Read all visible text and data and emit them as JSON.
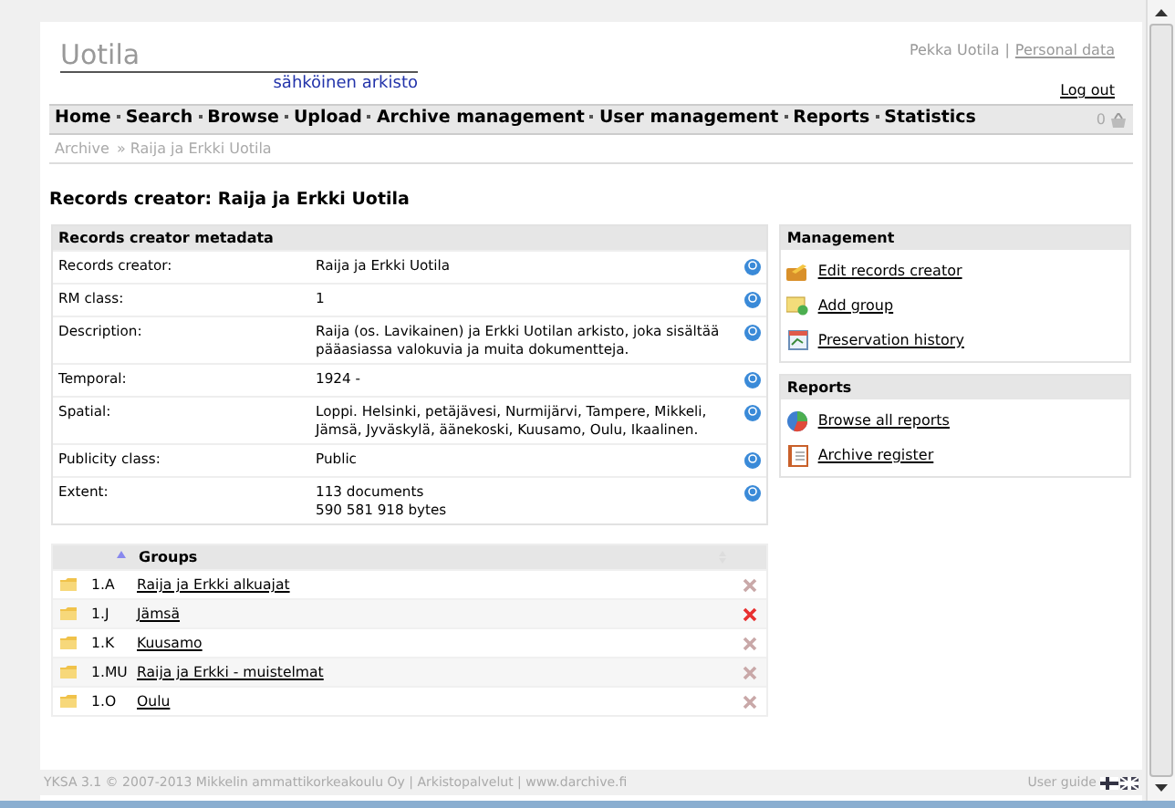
{
  "header": {
    "logo": "Uotila",
    "subtitle": "sähköinen arkisto",
    "user": "Pekka Uotila",
    "separator": "|",
    "personal_link": "Personal data",
    "logout": "Log out"
  },
  "nav": {
    "items": [
      "Home",
      "Search",
      "Browse",
      "Upload",
      "Archive management",
      "User management",
      "Reports",
      "Statistics"
    ],
    "basket_count": "0"
  },
  "breadcrumb": [
    "Archive",
    "» Raija ja Erkki Uotila"
  ],
  "page_title": "Records creator: Raija ja Erkki Uotila",
  "metadata": {
    "title": "Records creator metadata",
    "rows": [
      {
        "label": "Records creator:",
        "value": [
          "Raija ja Erkki Uotila"
        ]
      },
      {
        "label": "RM class:",
        "value": [
          "1"
        ]
      },
      {
        "label": "Description:",
        "value": [
          "Raija (os. Lavikainen) ja Erkki Uotilan arkisto, joka sisältää pääasiassa valokuvia ja muita dokumentteja."
        ]
      },
      {
        "label": "Temporal:",
        "value": [
          "1924 -"
        ]
      },
      {
        "label": "Spatial:",
        "value": [
          "Loppi. Helsinki, petäjävesi, Nurmijärvi, Tampere, Mikkeli, Jämsä, Jyväskylä, äänekoski, Kuusamo, Oulu, Ikaalinen."
        ]
      },
      {
        "label": "Publicity class:",
        "value": [
          "Public"
        ]
      },
      {
        "label": "Extent:",
        "value": [
          "113 documents",
          "590 581 918 bytes"
        ]
      }
    ]
  },
  "groups": {
    "column": "Groups",
    "rows": [
      {
        "code": "1.A",
        "name": "Raija ja Erkki alkuajat",
        "highlighted": false
      },
      {
        "code": "1.J",
        "name": "Jämsä",
        "highlighted": true
      },
      {
        "code": "1.K",
        "name": "Kuusamo",
        "highlighted": false
      },
      {
        "code": "1.MU",
        "name": "Raija ja Erkki - muistelmat",
        "highlighted": false
      },
      {
        "code": "1.O",
        "name": "Oulu",
        "highlighted": false
      }
    ]
  },
  "management": {
    "title": "Management",
    "links": [
      {
        "label": "Edit records creator",
        "kind": "edit"
      },
      {
        "label": "Add group",
        "kind": "add"
      },
      {
        "label": "Preservation history",
        "kind": "history"
      }
    ]
  },
  "reports": {
    "title": "Reports",
    "links": [
      {
        "label": "Browse all reports",
        "kind": "chart"
      },
      {
        "label": "Archive register",
        "kind": "register"
      }
    ]
  },
  "footer": {
    "text": "YKSA 3.1 © 2007-2013 Mikkelin ammattikorkeakoulu Oy | Arkistopalvelut | www.darchive.fi",
    "guide": "User guide"
  }
}
